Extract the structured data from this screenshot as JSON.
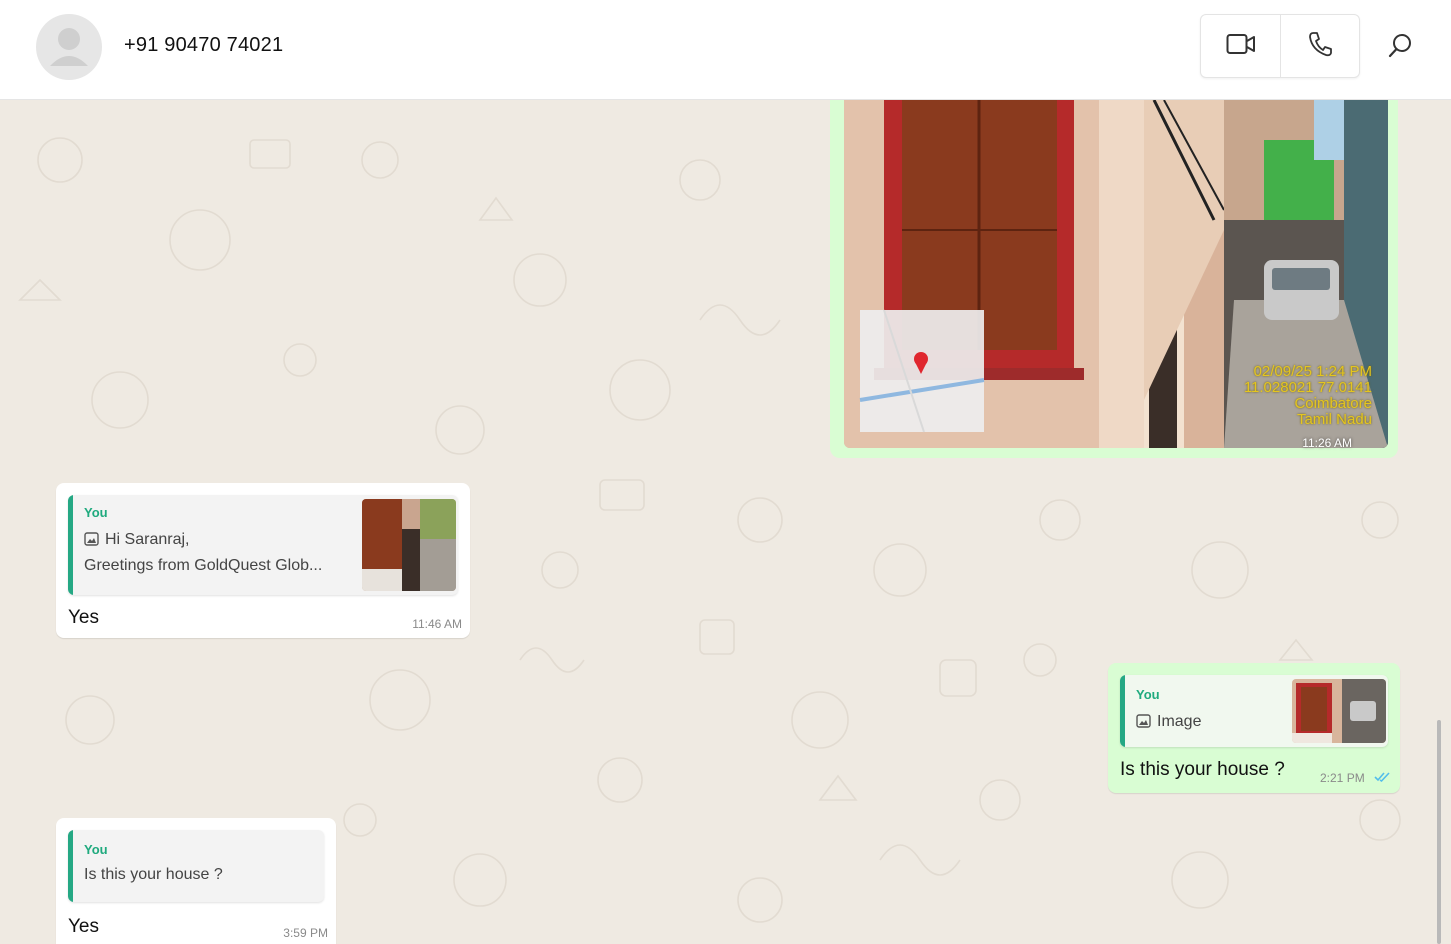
{
  "header": {
    "contact_name": "+91 90470 74021",
    "icons": {
      "video": "video-call-icon",
      "voice": "voice-call-icon",
      "search": "search-icon",
      "avatar": "default-avatar-icon"
    }
  },
  "colors": {
    "accent": "#25a884",
    "outgoing_bubble": "#d9fdd3",
    "incoming_bubble": "#ffffff",
    "chat_bg": "#efeae2",
    "read_tick": "#53bdeb"
  },
  "messages": [
    {
      "direction": "out",
      "type": "image",
      "image_overlay": {
        "date_time": "02/09/25 1:24 PM",
        "coords": "11.028021 77.0141",
        "place1": "Coimbatore",
        "place2": "Tamil Nadu"
      },
      "time": "11:26 AM"
    },
    {
      "direction": "in",
      "reply_to": {
        "author": "You",
        "line1": "Hi Saranraj,",
        "line2": "Greetings from GoldQuest Glob..."
      },
      "text": "Yes",
      "time": "11:46 AM"
    },
    {
      "direction": "out",
      "reply_to": {
        "author": "You",
        "line1": "Image"
      },
      "text": "Is this your house ?",
      "time": "2:21 PM",
      "status": "read"
    },
    {
      "direction": "in",
      "reply_to": {
        "author": "You",
        "line1": "Is this your house ?"
      },
      "text": "Yes",
      "time": "3:59 PM"
    }
  ]
}
